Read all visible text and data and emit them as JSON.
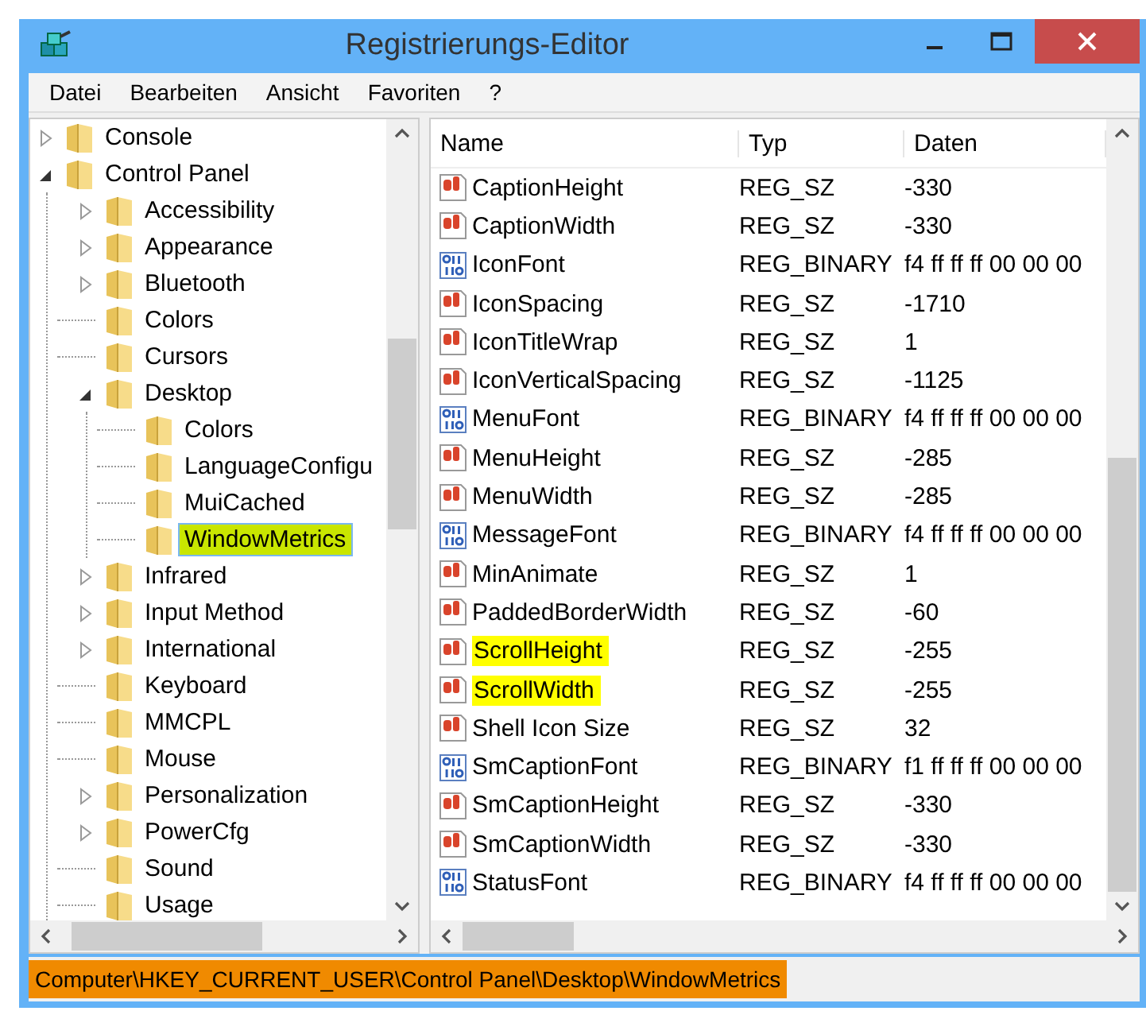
{
  "window": {
    "title": "Registrierungs-Editor"
  },
  "menu": [
    "Datei",
    "Bearbeiten",
    "Ansicht",
    "Favoriten",
    "?"
  ],
  "tree": [
    {
      "label": "Console",
      "kind": "collapsed",
      "selected": false,
      "highlighted": false
    },
    {
      "label": "Control Panel",
      "kind": "expanded",
      "selected": false,
      "highlighted": false,
      "children": [
        {
          "label": "Accessibility",
          "kind": "collapsed",
          "selected": false,
          "highlighted": false
        },
        {
          "label": "Appearance",
          "kind": "collapsed",
          "selected": false,
          "highlighted": false
        },
        {
          "label": "Bluetooth",
          "kind": "collapsed",
          "selected": false,
          "highlighted": false
        },
        {
          "label": "Colors",
          "kind": "leaf",
          "selected": false,
          "highlighted": false
        },
        {
          "label": "Cursors",
          "kind": "leaf",
          "selected": false,
          "highlighted": false
        },
        {
          "label": "Desktop",
          "kind": "expanded",
          "selected": false,
          "highlighted": false,
          "children": [
            {
              "label": "Colors",
              "kind": "leaf",
              "selected": false,
              "highlighted": false
            },
            {
              "label": "LanguageConfigu",
              "kind": "leaf",
              "selected": false,
              "highlighted": false
            },
            {
              "label": "MuiCached",
              "kind": "leaf",
              "selected": false,
              "highlighted": false
            },
            {
              "label": "WindowMetrics",
              "kind": "leaf",
              "selected": true,
              "highlighted": true
            }
          ]
        },
        {
          "label": "Infrared",
          "kind": "collapsed",
          "selected": false,
          "highlighted": false
        },
        {
          "label": "Input Method",
          "kind": "collapsed",
          "selected": false,
          "highlighted": false
        },
        {
          "label": "International",
          "kind": "collapsed",
          "selected": false,
          "highlighted": false
        },
        {
          "label": "Keyboard",
          "kind": "leaf",
          "selected": false,
          "highlighted": false
        },
        {
          "label": "MMCPL",
          "kind": "leaf",
          "selected": false,
          "highlighted": false
        },
        {
          "label": "Mouse",
          "kind": "leaf",
          "selected": false,
          "highlighted": false
        },
        {
          "label": "Personalization",
          "kind": "collapsed",
          "selected": false,
          "highlighted": false
        },
        {
          "label": "PowerCfg",
          "kind": "collapsed",
          "selected": false,
          "highlighted": false
        },
        {
          "label": "Sound",
          "kind": "leaf",
          "selected": false,
          "highlighted": false
        },
        {
          "label": "Usage",
          "kind": "leaf",
          "selected": false,
          "highlighted": false
        }
      ]
    }
  ],
  "table": {
    "columns": [
      "Name",
      "Typ",
      "Daten"
    ],
    "rows": [
      {
        "kind": "string",
        "name": "CaptionHeight",
        "type": "REG_SZ",
        "data": "-330",
        "highlighted": false
      },
      {
        "kind": "string",
        "name": "CaptionWidth",
        "type": "REG_SZ",
        "data": "-330",
        "highlighted": false
      },
      {
        "kind": "binary",
        "name": "IconFont",
        "type": "REG_BINARY",
        "data": "f4 ff ff ff 00 00 00",
        "highlighted": false
      },
      {
        "kind": "string",
        "name": "IconSpacing",
        "type": "REG_SZ",
        "data": "-1710",
        "highlighted": false
      },
      {
        "kind": "string",
        "name": "IconTitleWrap",
        "type": "REG_SZ",
        "data": "1",
        "highlighted": false
      },
      {
        "kind": "string",
        "name": "IconVerticalSpacing",
        "type": "REG_SZ",
        "data": "-1125",
        "highlighted": false
      },
      {
        "kind": "binary",
        "name": "MenuFont",
        "type": "REG_BINARY",
        "data": "f4 ff ff ff 00 00 00",
        "highlighted": false
      },
      {
        "kind": "string",
        "name": "MenuHeight",
        "type": "REG_SZ",
        "data": "-285",
        "highlighted": false
      },
      {
        "kind": "string",
        "name": "MenuWidth",
        "type": "REG_SZ",
        "data": "-285",
        "highlighted": false
      },
      {
        "kind": "binary",
        "name": "MessageFont",
        "type": "REG_BINARY",
        "data": "f4 ff ff ff 00 00 00",
        "highlighted": false
      },
      {
        "kind": "string",
        "name": "MinAnimate",
        "type": "REG_SZ",
        "data": "1",
        "highlighted": false
      },
      {
        "kind": "string",
        "name": "PaddedBorderWidth",
        "type": "REG_SZ",
        "data": "-60",
        "highlighted": false
      },
      {
        "kind": "string",
        "name": "ScrollHeight",
        "type": "REG_SZ",
        "data": "-255",
        "highlighted": true
      },
      {
        "kind": "string",
        "name": "ScrollWidth",
        "type": "REG_SZ",
        "data": "-255",
        "highlighted": true
      },
      {
        "kind": "string",
        "name": "Shell Icon Size",
        "type": "REG_SZ",
        "data": "32",
        "highlighted": false
      },
      {
        "kind": "binary",
        "name": "SmCaptionFont",
        "type": "REG_BINARY",
        "data": "f1 ff ff ff 00 00 00",
        "highlighted": false
      },
      {
        "kind": "string",
        "name": "SmCaptionHeight",
        "type": "REG_SZ",
        "data": "-330",
        "highlighted": false
      },
      {
        "kind": "string",
        "name": "SmCaptionWidth",
        "type": "REG_SZ",
        "data": "-330",
        "highlighted": false
      },
      {
        "kind": "binary",
        "name": "StatusFont",
        "type": "REG_BINARY",
        "data": "f4 ff ff ff 00 00 00",
        "highlighted": false
      }
    ]
  },
  "status_bar": {
    "path": "Computer\\HKEY_CURRENT_USER\\Control Panel\\Desktop\\WindowMetrics",
    "highlighted": true
  }
}
